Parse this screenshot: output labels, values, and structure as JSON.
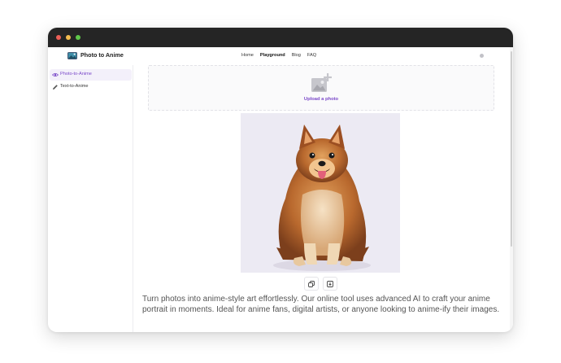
{
  "brand": {
    "name": "Photo to Anime",
    "icon": "image-logo-icon"
  },
  "nav": {
    "home": "Home",
    "playground": "Playground",
    "blog": "Blog",
    "faq": "FAQ",
    "active": "Playground"
  },
  "sidebar": {
    "items": [
      {
        "label": "Photo-to-Anime",
        "icon": "eye-icon",
        "active": true
      },
      {
        "label": "Text-to-Anime",
        "icon": "pencil-icon",
        "active": false
      }
    ]
  },
  "upload": {
    "label": "Upload a photo",
    "icon": "add-image-icon"
  },
  "preview": {
    "subject": "anime-style Pomeranian dog"
  },
  "actions": [
    {
      "icon": "copy-icon"
    },
    {
      "icon": "download-icon"
    }
  ],
  "description": "Turn photos into anime-style art effortlessly. Our online tool uses advanced AI to craft your anime portrait in moments. Ideal for anime fans, digital artists, or anyone looking to anime-ify their images.",
  "colors": {
    "accent": "#7a48c9",
    "titlebar": "#252525"
  }
}
